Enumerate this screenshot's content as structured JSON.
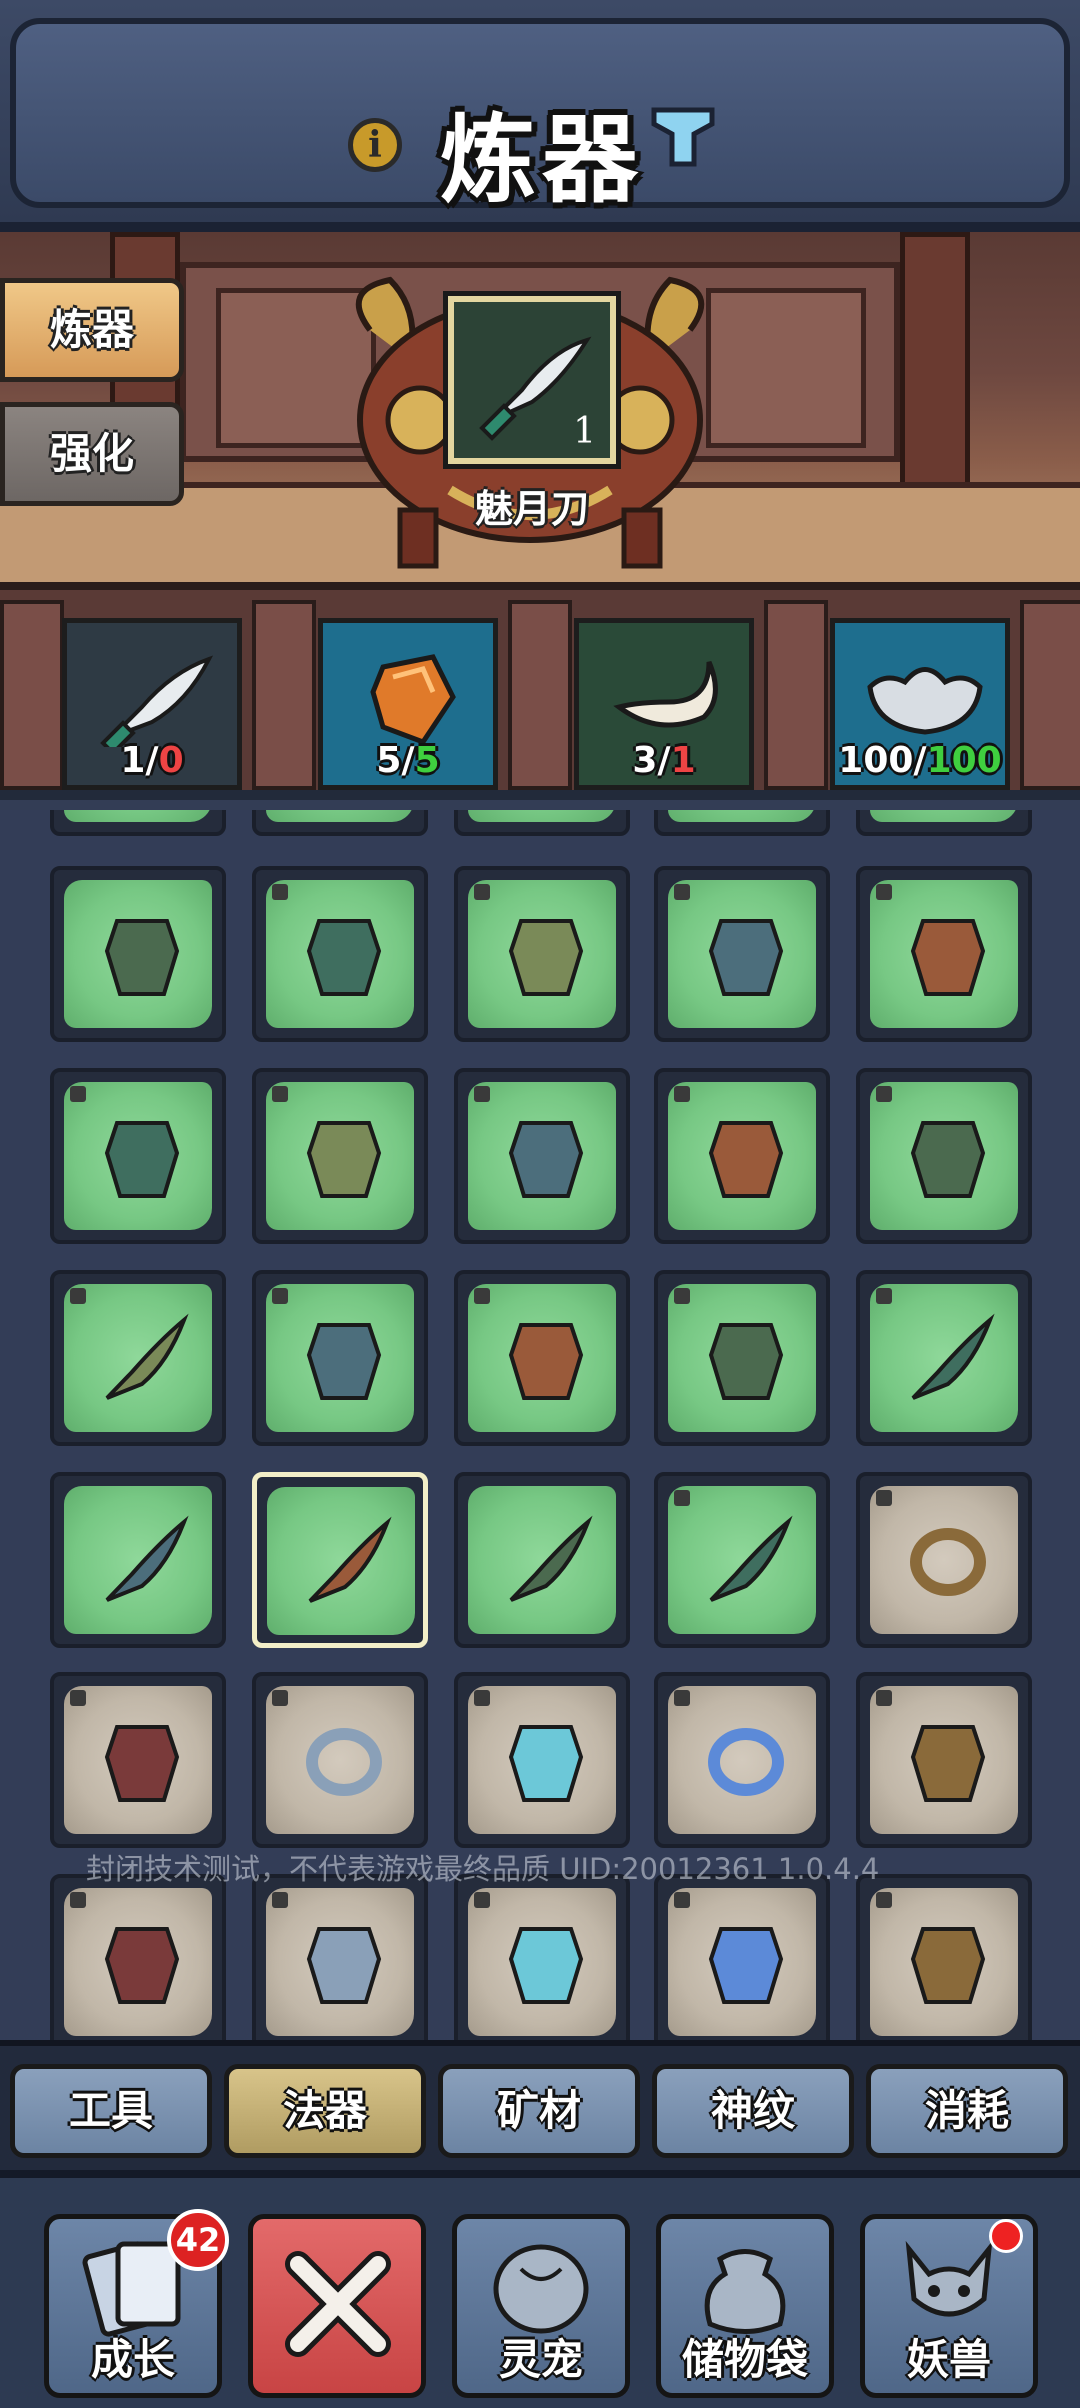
{
  "header": {
    "title": "炼器",
    "info_icon": "info-icon",
    "filter_icon": "funnel-icon"
  },
  "side_tabs": [
    {
      "label": "炼器",
      "active": true
    },
    {
      "label": "强化",
      "active": false
    }
  ],
  "selected_item": {
    "name": "魅月刀",
    "quantity": "1",
    "icon": "curved-dagger-icon"
  },
  "materials": [
    {
      "icon": "curved-dagger-icon",
      "have": "1/",
      "need": "0",
      "need_ok": false,
      "bg": "#2e3a44"
    },
    {
      "icon": "amber-gem-icon",
      "have": "5/",
      "need": "5",
      "need_ok": true,
      "bg": "#1e6e8e"
    },
    {
      "icon": "horn-icon",
      "have": "3/",
      "need": "1",
      "need_ok": false,
      "bg": "#2a4a38"
    },
    {
      "icon": "silver-ingot-icon",
      "have": "100/",
      "need": "100",
      "need_ok": true,
      "bg": "#1e6e8e"
    }
  ],
  "grid": {
    "rows": [
      [
        "green",
        "green",
        "green",
        "green",
        "green"
      ],
      [
        "green",
        "green",
        "green",
        "green",
        "green"
      ],
      [
        "green",
        "green",
        "green",
        "green",
        "green"
      ],
      [
        "green",
        "green",
        "green",
        "green",
        "gray"
      ],
      [
        "gray",
        "gray",
        "gray",
        "gray",
        "gray"
      ],
      [
        "gray",
        "gray",
        "gray",
        "gray",
        "gray"
      ]
    ],
    "icons": [
      [
        "leg-armor-icon",
        "bracer-icon",
        "shin-guard-icon",
        "greaves-icon",
        "chest-armor-icon"
      ],
      [
        "heavy-armor-icon",
        "robe-icon",
        "horned-armor-icon",
        "blue-armor-icon",
        "mask-icon"
      ],
      [
        "fang-icon",
        "banner-icon",
        "talisman-icon",
        "pipa-icon",
        "spear-icon"
      ],
      [
        "sabre-icon",
        "curved-dagger-icon",
        "short-sword-icon",
        "long-sword-icon",
        "ring-icon"
      ],
      [
        "flame-pendant-icon",
        "silver-ring-icon",
        "crystal-icon",
        "blue-ring-icon",
        "boots-icon"
      ],
      [
        "dark-leggings-icon",
        "jade-leggings-icon",
        "gold-leggings-icon",
        "blue-leggings-icon",
        "dragon-armor-icon"
      ]
    ],
    "selected": [
      3,
      1
    ]
  },
  "watermark": "封闭技术测试，不代表游戏最终品质 UID:20012361 1.0.4.4",
  "category_tabs": [
    {
      "label": "工具",
      "active": false
    },
    {
      "label": "法器",
      "active": true
    },
    {
      "label": "矿材",
      "active": false
    },
    {
      "label": "神纹",
      "active": false
    },
    {
      "label": "消耗",
      "active": false
    }
  ],
  "nav": [
    {
      "label": "成长",
      "badge": "42",
      "icon": "cards-icon"
    },
    {
      "label": "",
      "icon": "close-icon"
    },
    {
      "label": "灵宠",
      "icon": "pet-egg-icon"
    },
    {
      "label": "储物袋",
      "icon": "bag-icon"
    },
    {
      "label": "妖兽",
      "icon": "beast-icon",
      "dot": true
    }
  ]
}
